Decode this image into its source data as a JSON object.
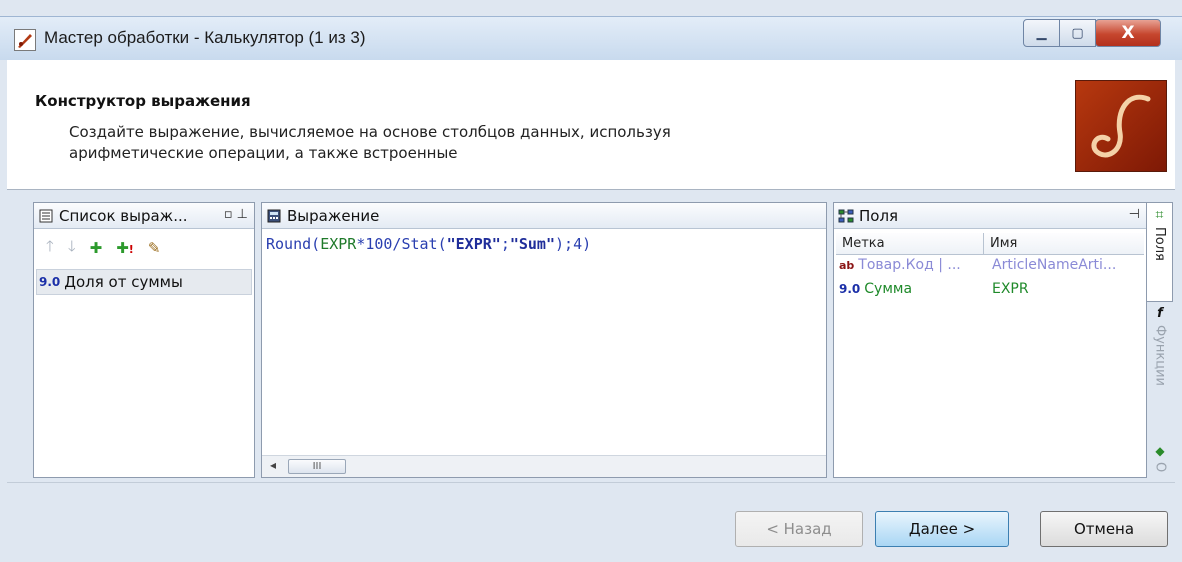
{
  "window": {
    "title": "Мастер обработки - Калькулятор (1 из 3)",
    "minimize_glyph": "▁",
    "maximize_glyph": "▢",
    "close_glyph": "X"
  },
  "header": {
    "title": "Конструктор выражения",
    "description": "Создайте выражение, вычисляемое на основе столбцов данных, используя арифметические операции, а также встроенные"
  },
  "expressions_panel": {
    "title": "Список выраж...",
    "icon": "list-icon",
    "items": [
      {
        "type_badge": "9.0",
        "label": "Доля от суммы"
      }
    ]
  },
  "expression_panel": {
    "title": "Выражение",
    "icon": "calculator-icon",
    "tokens": {
      "fn1": "Round",
      "p1": "(",
      "field1": "EXPR",
      "op1": "*100/",
      "fn2": "Stat",
      "p2": "(",
      "str1": "\"EXPR\"",
      "sep1": ";",
      "str2": "\"Sum\"",
      "p3": ")",
      "sep2": ";",
      "num": "4",
      "p4": ")"
    },
    "scroll_thumb": "III"
  },
  "fields_panel": {
    "title": "Поля",
    "icon": "fields-icon",
    "columns": [
      "Метка",
      "Имя"
    ],
    "rows": [
      {
        "badge": "ab",
        "label": "Товар.Код | ...",
        "name": "ArticleNameArti..."
      },
      {
        "badge": "9.0",
        "label": "Сумма",
        "name": "EXPR"
      }
    ]
  },
  "side_tabs": [
    {
      "label": "Поля",
      "icon": "fields-icon"
    },
    {
      "label": "Функции",
      "icon": "function-icon"
    },
    {
      "label": "О",
      "icon": "ops-icon"
    }
  ],
  "footer": {
    "back": "< Назад",
    "next": "Далее >",
    "cancel": "Отмена"
  },
  "colors": {
    "field_green": "#1f7a2a",
    "function_blue": "#2a3fb0",
    "close_red": "#c6462e"
  }
}
